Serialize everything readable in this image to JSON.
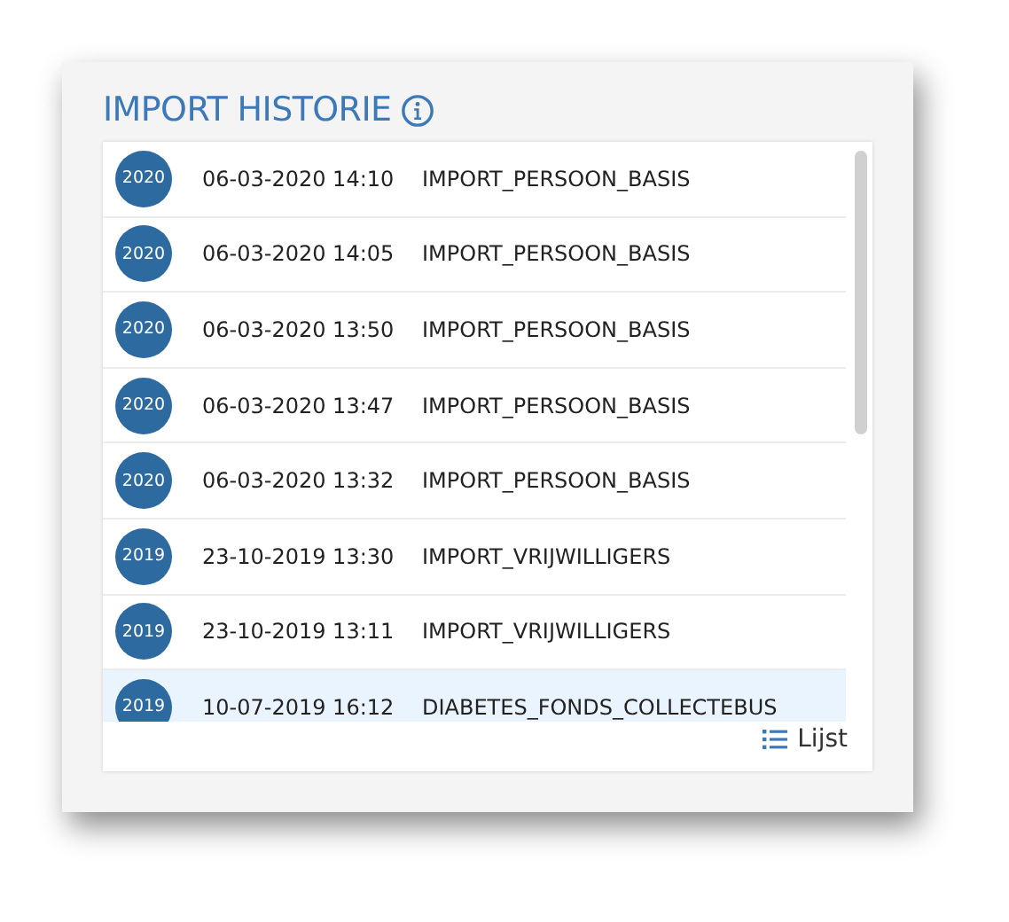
{
  "title": "IMPORT HISTORIE",
  "imports": [
    {
      "year": "2020",
      "datetime": "06-03-2020 14:10",
      "name": "IMPORT_PERSOON_BASIS",
      "selected": false
    },
    {
      "year": "2020",
      "datetime": "06-03-2020 14:05",
      "name": "IMPORT_PERSOON_BASIS",
      "selected": false
    },
    {
      "year": "2020",
      "datetime": "06-03-2020 13:50",
      "name": "IMPORT_PERSOON_BASIS",
      "selected": false
    },
    {
      "year": "2020",
      "datetime": "06-03-2020 13:47",
      "name": "IMPORT_PERSOON_BASIS",
      "selected": false
    },
    {
      "year": "2020",
      "datetime": "06-03-2020 13:32",
      "name": "IMPORT_PERSOON_BASIS",
      "selected": false
    },
    {
      "year": "2019",
      "datetime": "23-10-2019 13:30",
      "name": "IMPORT_VRIJWILLIGERS",
      "selected": false
    },
    {
      "year": "2019",
      "datetime": "23-10-2019 13:11",
      "name": "IMPORT_VRIJWILLIGERS",
      "selected": false
    },
    {
      "year": "2019",
      "datetime": "10-07-2019 16:12",
      "name": "DIABETES_FONDS_COLLECTEBUS",
      "selected": true
    }
  ],
  "footer_link": "Lijst"
}
